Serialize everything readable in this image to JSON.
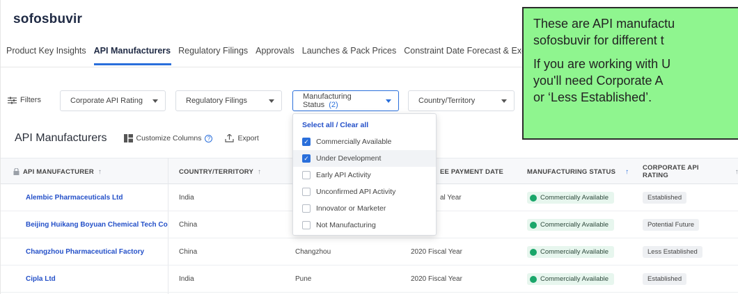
{
  "product": {
    "title": "sofosbuvir"
  },
  "tabs": [
    {
      "label": "Product Key Insights",
      "active": false
    },
    {
      "label": "API Manufacturers",
      "active": true
    },
    {
      "label": "Regulatory Filings",
      "active": false
    },
    {
      "label": "Approvals",
      "active": false
    },
    {
      "label": "Launches & Pack Prices",
      "active": false
    },
    {
      "label": "Constraint Date Forecast & Exclusivities",
      "active": false
    }
  ],
  "filters": {
    "button_label": "Filters",
    "corporate_api_rating": "Corporate API Rating",
    "regulatory_filings": "Regulatory Filings",
    "manufacturing_status": "Manufacturing Status",
    "manufacturing_status_count": "(2)",
    "country_territory": "Country/Territory"
  },
  "dropdown": {
    "select_all": "Select all",
    "separator": " / ",
    "clear_all": "Clear all",
    "options": [
      {
        "label": "Commercially Available",
        "checked": true
      },
      {
        "label": "Under Development",
        "checked": true
      },
      {
        "label": "Early API Activity",
        "checked": false
      },
      {
        "label": "Unconfirmed API Activity",
        "checked": false
      },
      {
        "label": "Innovator or Marketer",
        "checked": false
      },
      {
        "label": "Not Manufacturing",
        "checked": false
      }
    ]
  },
  "section": {
    "title": "API Manufacturers",
    "customize_label": "Customize Columns",
    "help_glyph": "?",
    "export_label": "Export"
  },
  "table": {
    "headers": {
      "manufacturer": "API MANUFACTURER",
      "country": "COUNTRY/TERRITORY",
      "payment_date": "EE PAYMENT DATE",
      "status": "MANUFACTURING STATUS",
      "rating": "CORPORATE API RATING"
    },
    "rows": [
      {
        "manufacturer": "Alembic Pharmaceuticals Ltd",
        "country": "India",
        "city": "",
        "payment": "al Year",
        "status": "Commercially Available",
        "rating": "Established"
      },
      {
        "manufacturer": "Beijing Huikang Boyuan Chemical Tech Co",
        "country": "China",
        "city": "",
        "payment": "",
        "status": "Commercially Available",
        "rating": "Potential Future"
      },
      {
        "manufacturer": "Changzhou Pharmaceutical Factory",
        "country": "China",
        "city": "Changzhou",
        "payment": "2020 Fiscal Year",
        "status": "Commercially Available",
        "rating": "Less Established"
      },
      {
        "manufacturer": "Cipla Ltd",
        "country": "India",
        "city": "Pune",
        "payment": "2020 Fiscal Year",
        "status": "Commercially Available",
        "rating": "Established"
      }
    ]
  },
  "callout": {
    "line1": "These are API manufactu",
    "line2": "sofosbuvir for different t",
    "line3": "If you are working with U",
    "line4": "you'll need Corporate A",
    "line5": "or ‘Less Established’."
  },
  "colors": {
    "accent": "#2a6fdb",
    "link": "#2450c8",
    "status_green": "#1aa66a",
    "callout_bg": "#8ff58f"
  }
}
